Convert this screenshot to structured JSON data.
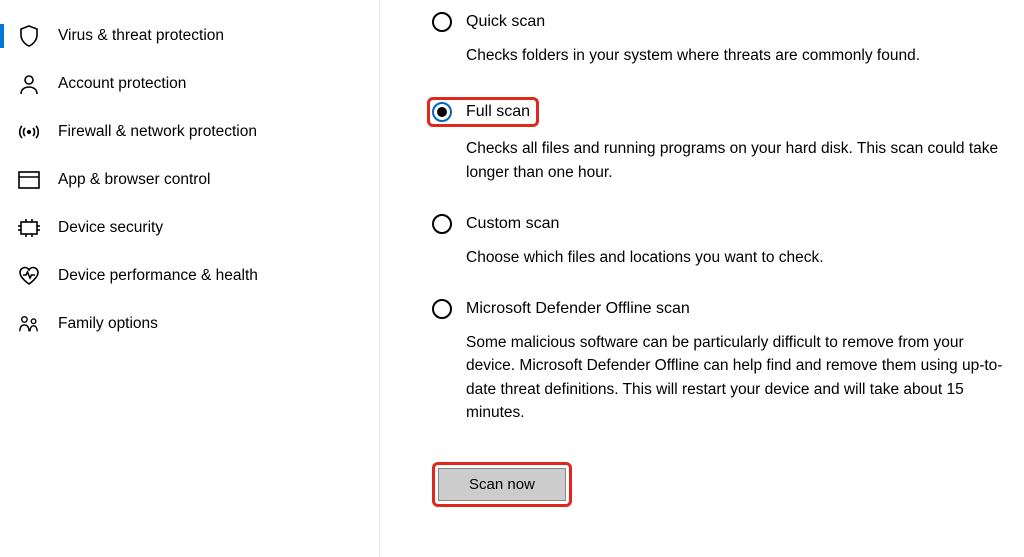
{
  "sidebar": {
    "items": [
      {
        "label": "Virus & threat protection"
      },
      {
        "label": "Account protection"
      },
      {
        "label": "Firewall & network protection"
      },
      {
        "label": "App & browser control"
      },
      {
        "label": "Device security"
      },
      {
        "label": "Device performance & health"
      },
      {
        "label": "Family options"
      }
    ]
  },
  "options": {
    "quick": {
      "label": "Quick scan",
      "desc": "Checks folders in your system where threats are commonly found."
    },
    "full": {
      "label": "Full scan",
      "desc": "Checks all files and running programs on your hard disk. This scan could take longer than one hour."
    },
    "custom": {
      "label": "Custom scan",
      "desc": "Choose which files and locations you want to check."
    },
    "offline": {
      "label": "Microsoft Defender Offline scan",
      "desc": "Some malicious software can be particularly difficult to remove from your device. Microsoft Defender Offline can help find and remove them using up-to-date threat definitions. This will restart your device and will take about 15 minutes."
    }
  },
  "buttons": {
    "scan_now": "Scan now"
  }
}
